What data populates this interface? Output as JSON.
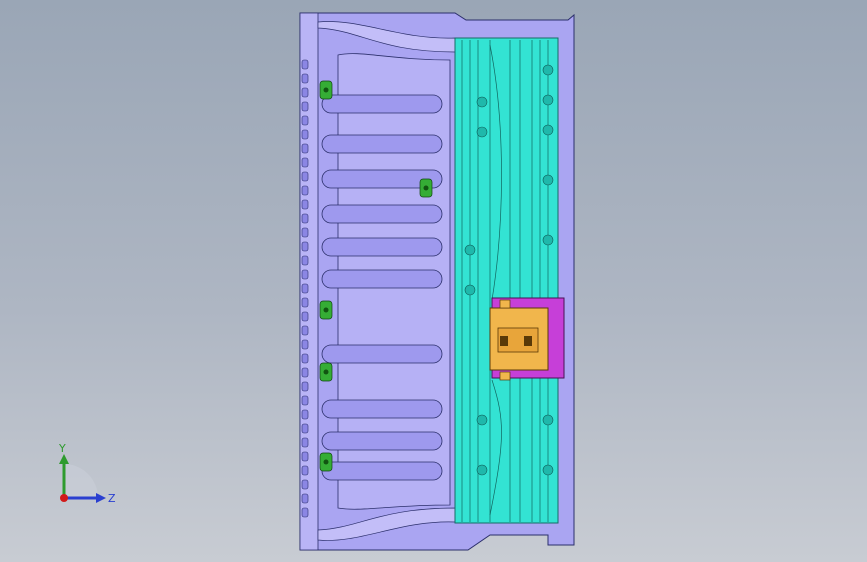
{
  "viewport": {
    "background_top": "#9aa6b6",
    "background_bottom": "#c8ccd3"
  },
  "model": {
    "base_color": "#a9a4f0",
    "line_color": "#2b2f6b",
    "die_color": "#2ee6d6",
    "insert_yellow": "#f0b64a",
    "insert_magenta": "#c43bd7",
    "clip_green": "#33aa33"
  },
  "triad": {
    "y_label": "Y",
    "z_label": "Z",
    "y_color": "#2e9b2e",
    "z_color": "#2a3fd0",
    "x_color": "#d11a1a"
  }
}
